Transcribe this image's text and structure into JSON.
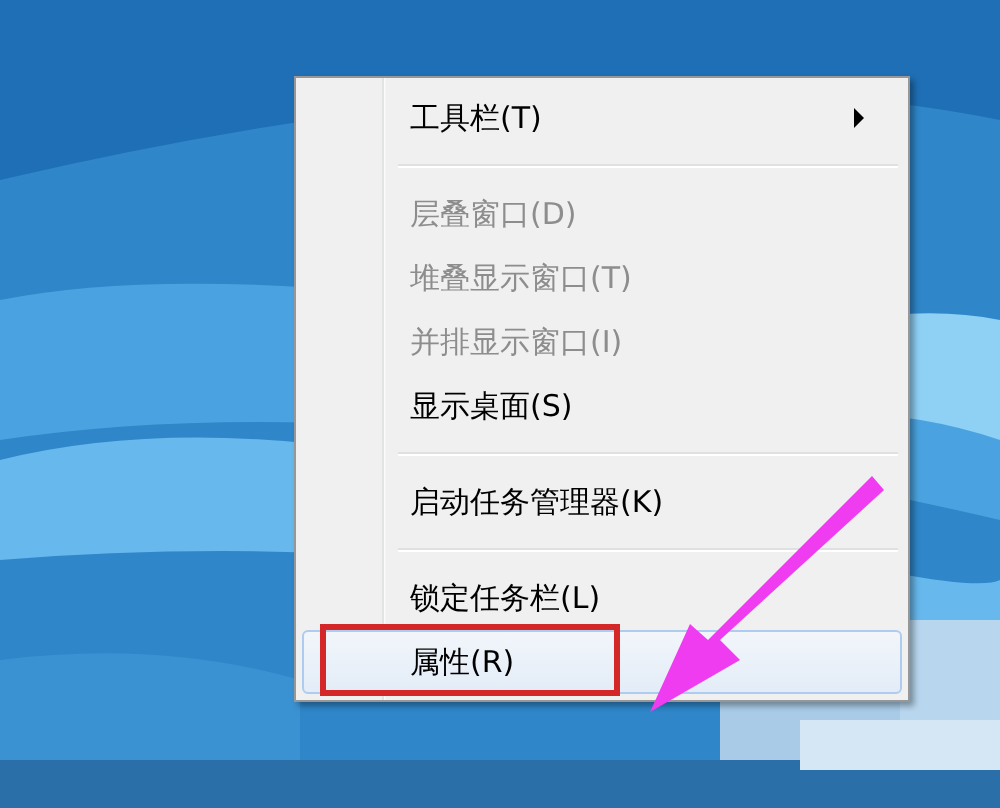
{
  "context_menu": {
    "items": [
      {
        "kind": "item",
        "label": "工具栏(T)",
        "submenu": true,
        "disabled": false,
        "selected": false
      },
      {
        "kind": "separator"
      },
      {
        "kind": "item",
        "label": "层叠窗口(D)",
        "disabled": true,
        "selected": false
      },
      {
        "kind": "item",
        "label": "堆叠显示窗口(T)",
        "disabled": true,
        "selected": false
      },
      {
        "kind": "item",
        "label": "并排显示窗口(I)",
        "disabled": true,
        "selected": false
      },
      {
        "kind": "item",
        "label": "显示桌面(S)",
        "disabled": false,
        "selected": false
      },
      {
        "kind": "separator"
      },
      {
        "kind": "item",
        "label": "启动任务管理器(K)",
        "disabled": false,
        "selected": false
      },
      {
        "kind": "separator"
      },
      {
        "kind": "item",
        "label": "锁定任务栏(L)",
        "disabled": false,
        "selected": false
      },
      {
        "kind": "item",
        "label": "属性(R)",
        "disabled": false,
        "selected": true,
        "highlighted": true
      }
    ]
  }
}
